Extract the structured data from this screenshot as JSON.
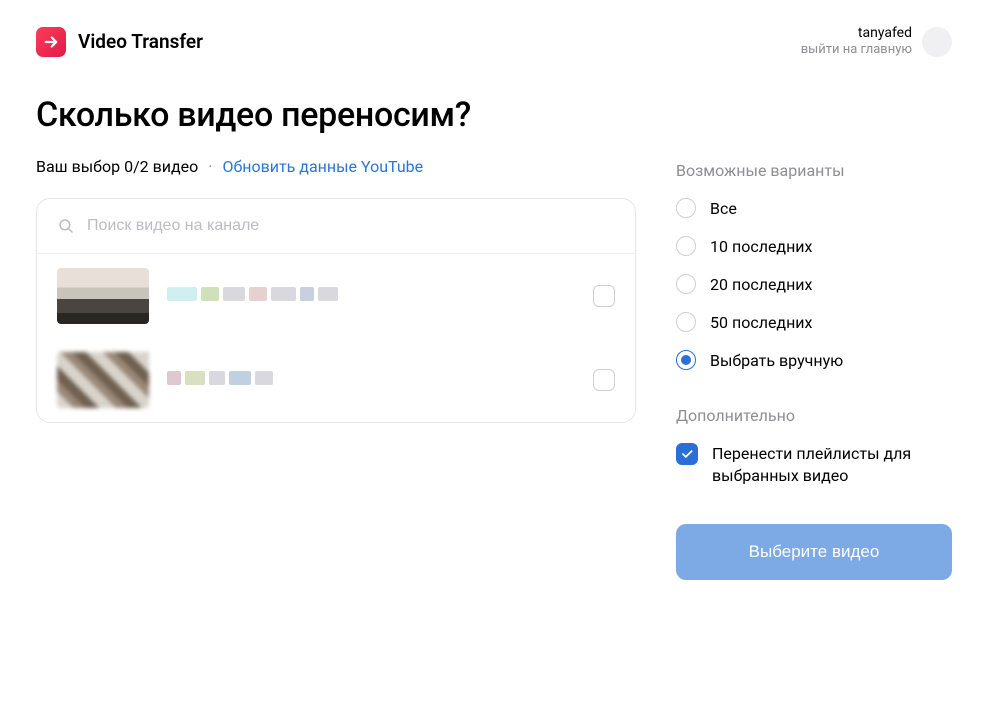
{
  "header": {
    "brand_title": "Video Transfer",
    "username": "tanyafed",
    "user_sub": "выйти на главную"
  },
  "page": {
    "title": "Сколько видео переносим?",
    "selection_text": "Ваш выбор 0/2 видео",
    "refresh_link": "Обновить данные YouTube",
    "search_placeholder": "Поиск видео на канале"
  },
  "options": {
    "section_label": "Возможные варианты",
    "items": [
      {
        "label": "Все",
        "selected": false
      },
      {
        "label": "10 последних",
        "selected": false
      },
      {
        "label": "20 последних",
        "selected": false
      },
      {
        "label": "50 последних",
        "selected": false
      },
      {
        "label": "Выбрать вручную",
        "selected": true
      }
    ]
  },
  "extra": {
    "section_label": "Дополнительно",
    "playlists_label": "Перенести плейлисты для выбранных видео",
    "playlists_checked": true
  },
  "cta_label": "Выберите видео",
  "videos": [
    {
      "checked": false
    },
    {
      "checked": false
    }
  ]
}
